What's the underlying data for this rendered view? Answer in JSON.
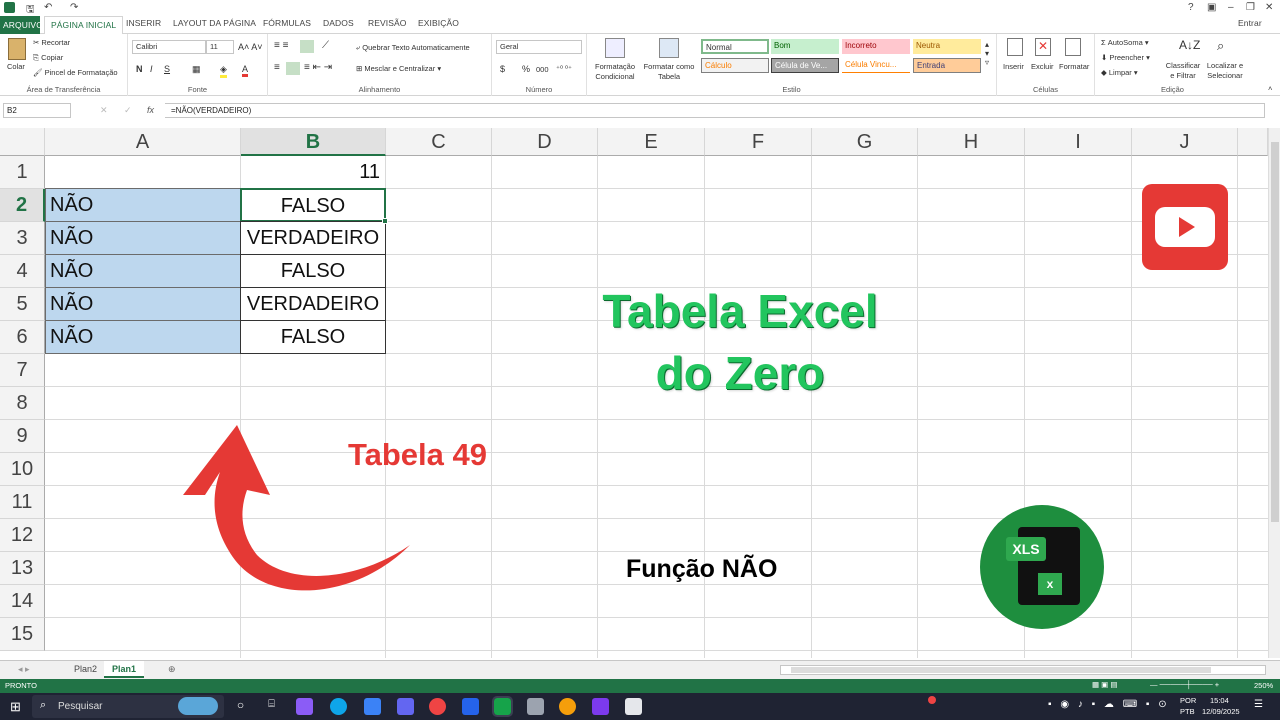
{
  "window": {
    "signin": "Entrar",
    "help": "?",
    "minimize": "–",
    "restore": "❐",
    "close": "✕"
  },
  "ribbon_tabs": {
    "file": "ARQUIVO",
    "home": "PÁGINA INICIAL",
    "insert": "INSERIR",
    "layout": "LAYOUT DA PÁGINA",
    "formulas": "FÓRMULAS",
    "data": "DADOS",
    "review": "REVISÃO",
    "view": "EXIBIÇÃO"
  },
  "ribbon": {
    "clipboard": {
      "paste": "Colar",
      "cut": "Recortar",
      "copy": "Copiar",
      "painter": "Pincel de Formatação",
      "label": "Área de Transferência"
    },
    "font": {
      "name": "Calibri",
      "size": "11",
      "bold": "N",
      "italic": "I",
      "underline": "S",
      "label": "Fonte"
    },
    "alignment": {
      "wrap": "Quebrar Texto Automaticamente",
      "merge": "Mesclar e Centralizar",
      "label": "Alinhamento"
    },
    "number": {
      "format": "Geral",
      "currency": "$",
      "percent": "%",
      "thousands": "000",
      "label": "Número"
    },
    "styles": {
      "conditional": "Formatação Condicional",
      "as_table": "Formatar como Tabela",
      "normal": "Normal",
      "good": "Bom",
      "bad": "Incorreto",
      "neutral": "Neutra",
      "calc": "Cálculo",
      "check": "Célula de Ve...",
      "linked": "Célula Vincu...",
      "input": "Entrada",
      "label": "Estilo"
    },
    "cells": {
      "insert": "Inserir",
      "delete": "Excluir",
      "format": "Formatar",
      "label": "Células"
    },
    "editing": {
      "autosum": "AutoSoma",
      "fill": "Preencher",
      "clear": "Limpar",
      "sort": "Classificar e Filtrar",
      "find": "Localizar e Selecionar",
      "label": "Edição"
    }
  },
  "formula_bar": {
    "name_box": "B2",
    "fx": "fx",
    "formula": "=NÃO(VERDADEIRO)"
  },
  "columns": [
    "A",
    "B",
    "C",
    "D",
    "E",
    "F",
    "G",
    "H",
    "I",
    "J"
  ],
  "rows": [
    "1",
    "2",
    "3",
    "4",
    "5",
    "6",
    "7",
    "8",
    "9",
    "10",
    "11",
    "12",
    "13",
    "14",
    "15"
  ],
  "cells": {
    "B1": "11",
    "A": [
      "NÃO",
      "NÃO",
      "NÃO",
      "NÃO",
      "NÃO"
    ],
    "B": [
      "FALSO",
      "VERDADEIRO",
      "FALSO",
      "VERDADEIRO",
      "FALSO"
    ]
  },
  "overlay": {
    "title_line1": "Tabela Excel",
    "title_line2": "do Zero",
    "table_label": "Tabela 49",
    "function_label": "Função NÃO",
    "xls_badge": "XLS",
    "xls_mark": "x"
  },
  "sheets": [
    "Plan2",
    "Plan1"
  ],
  "active_sheet": "Plan1",
  "status": {
    "mode": "PRONTO",
    "zoom": "250%"
  },
  "taskbar": {
    "search": "Pesquisar",
    "lang1": "POR",
    "lang2": "PTB",
    "time": "15:04",
    "date": "12/09/2025"
  },
  "colors": {
    "excel_green": "#217346",
    "title_green": "#22c55e",
    "red": "#e53935",
    "selected_fill": "#bdd7ee"
  }
}
